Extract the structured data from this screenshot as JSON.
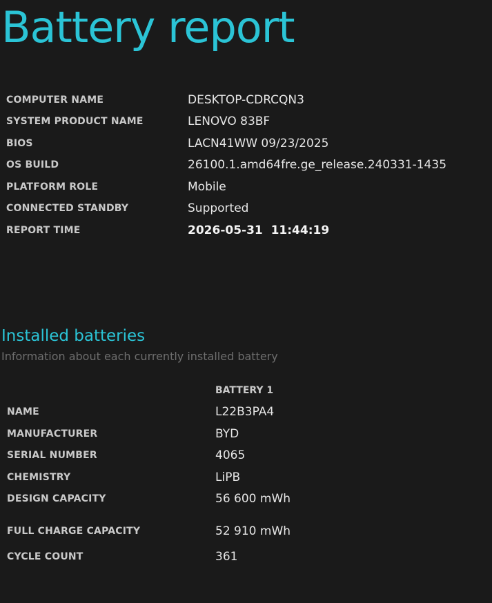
{
  "title": "Battery report",
  "system_info": [
    {
      "label": "COMPUTER NAME",
      "value": "DESKTOP-CDRCQN3"
    },
    {
      "label": "SYSTEM PRODUCT NAME",
      "value": "LENOVO 83BF"
    },
    {
      "label": "BIOS",
      "value": "LACN41WW 09/23/2025"
    },
    {
      "label": "OS BUILD",
      "value": "26100.1.amd64fre.ge_release.240331-1435"
    },
    {
      "label": "PLATFORM ROLE",
      "value": "Mobile"
    },
    {
      "label": "CONNECTED STANDBY",
      "value": "Supported"
    },
    {
      "label": "REPORT TIME",
      "value": "2026-05-31  11:44:19"
    }
  ],
  "installed_batteries": {
    "title": "Installed batteries",
    "subtitle": "Information about each currently installed battery",
    "column_header": "BATTERY 1",
    "rows": [
      {
        "label": "NAME",
        "value": "L22B3PA4"
      },
      {
        "label": "MANUFACTURER",
        "value": "BYD"
      },
      {
        "label": "SERIAL NUMBER",
        "value": "4065"
      },
      {
        "label": "CHEMISTRY",
        "value": "LiPB"
      },
      {
        "label": "DESIGN CAPACITY",
        "value": "56 600 mWh"
      },
      {
        "label": "FULL CHARGE CAPACITY",
        "value": "52 910 mWh"
      },
      {
        "label": "CYCLE COUNT",
        "value": "361"
      }
    ]
  },
  "colors": {
    "background": "#1a1a1a",
    "accent": "#2bc4d6",
    "label": "#c9c9c9",
    "value": "#e6e6e6",
    "subtitle": "#6e6e6e"
  }
}
